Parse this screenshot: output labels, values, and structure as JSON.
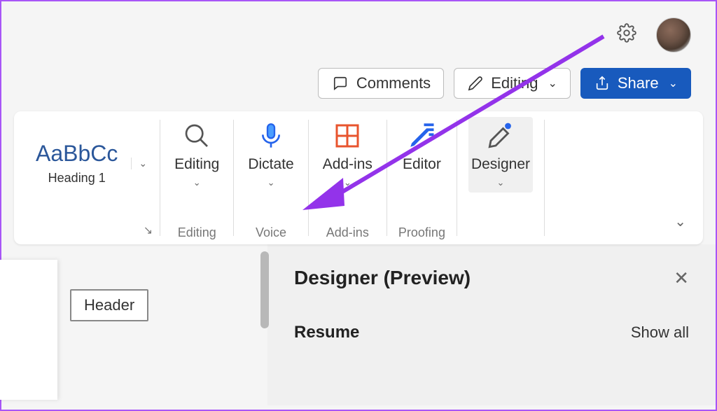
{
  "header": {
    "settings_icon": "gear-icon",
    "avatar": "user-avatar"
  },
  "actions": {
    "comments_label": "Comments",
    "editing_label": "Editing",
    "share_label": "Share"
  },
  "ribbon": {
    "style": {
      "preview": "AaBbCc",
      "name": "Heading 1"
    },
    "groups": {
      "editing": {
        "button": "Editing",
        "group": "Editing"
      },
      "voice": {
        "button": "Dictate",
        "group": "Voice"
      },
      "addins": {
        "button": "Add-ins",
        "group": "Add-ins"
      },
      "proofing": {
        "button": "Editor",
        "group": "Proofing"
      },
      "designer": {
        "button": "Designer"
      }
    }
  },
  "document": {
    "header_tag": "Header"
  },
  "designer_pane": {
    "title": "Designer (Preview)",
    "section": "Resume",
    "show_all": "Show all"
  },
  "colors": {
    "primary": "#185abd",
    "wordblue": "#2b579a",
    "arrow": "#9333ea"
  }
}
